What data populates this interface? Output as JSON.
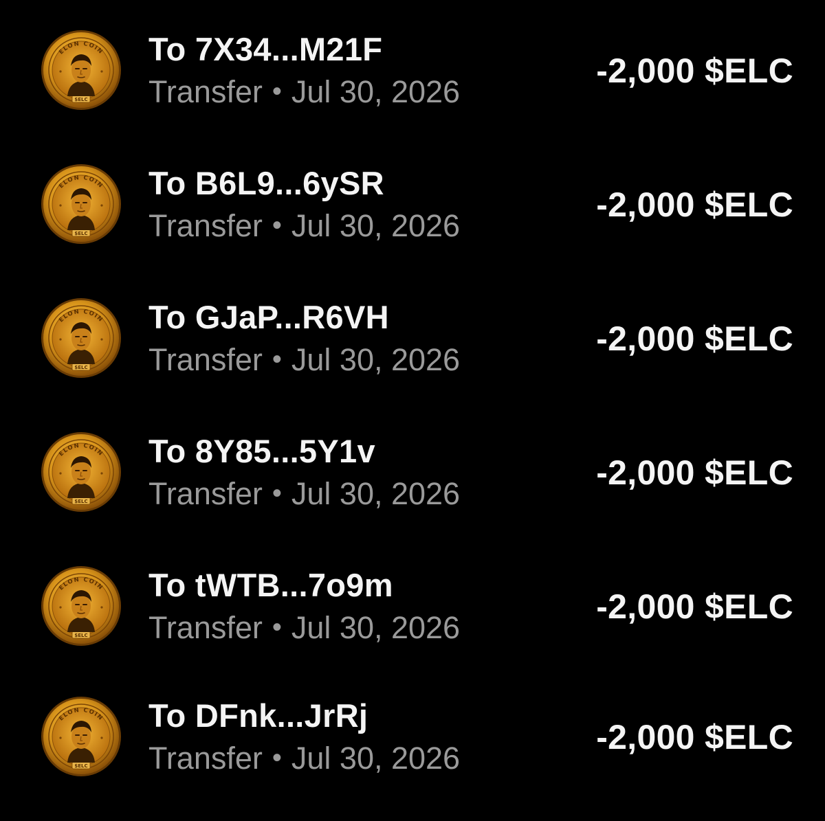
{
  "transactions": [
    {
      "recipient": "To 7X34...M21F",
      "type": "Transfer",
      "separator": "•",
      "date": "Jul 30, 2026",
      "amount": "-2,000 $ELC",
      "icon": "elon-coin-icon"
    },
    {
      "recipient": "To B6L9...6ySR",
      "type": "Transfer",
      "separator": "•",
      "date": "Jul 30, 2026",
      "amount": "-2,000 $ELC",
      "icon": "elon-coin-icon"
    },
    {
      "recipient": "To GJaP...R6VH",
      "type": "Transfer",
      "separator": "•",
      "date": "Jul 30, 2026",
      "amount": "-2,000 $ELC",
      "icon": "elon-coin-icon"
    },
    {
      "recipient": "To 8Y85...5Y1v",
      "type": "Transfer",
      "separator": "•",
      "date": "Jul 30, 2026",
      "amount": "-2,000 $ELC",
      "icon": "elon-coin-icon"
    },
    {
      "recipient": "To tWTB...7o9m",
      "type": "Transfer",
      "separator": "•",
      "date": "Jul 30, 2026",
      "amount": "-2,000 $ELC",
      "icon": "elon-coin-icon"
    },
    {
      "recipient": "To DFnk...JrRj",
      "type": "Transfer",
      "separator": "•",
      "date": "Jul 30, 2026",
      "amount": "-2,000 $ELC",
      "icon": "elon-coin-icon"
    }
  ],
  "coin": {
    "top_text": "ELON COIN",
    "bottom_text": "$ELC"
  },
  "colors": {
    "background": "#000000",
    "primary_text": "#f4f4f4",
    "secondary_text": "#9a9a9a",
    "coin_gold": "#d99a1e"
  }
}
